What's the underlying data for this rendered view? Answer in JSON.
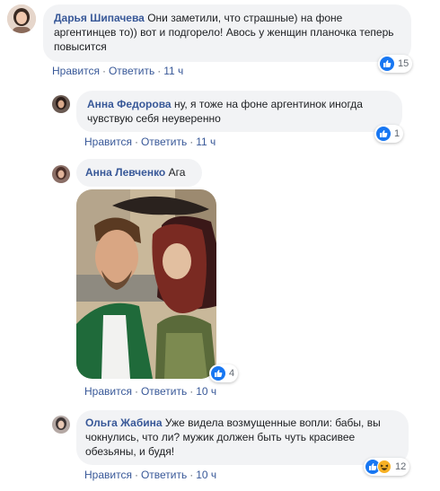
{
  "comments": [
    {
      "author": "Дарья Шипачева",
      "text": "Они заметили, что страшные) на фоне аргентинцев то)) вот и подгорело! Авось у женщин планочка теперь повысится",
      "like_label": "Нравится",
      "reply_label": "Ответить",
      "time": "11 ч",
      "reactions": [
        "like-icon"
      ],
      "reaction_count": "15"
    },
    {
      "author": "Анна Федорова",
      "text": "ну, я тоже на фоне аргентинок иногда чувствую себя неуверенно",
      "like_label": "Нравится",
      "reply_label": "Ответить",
      "time": "11 ч",
      "reactions": [
        "like-icon"
      ],
      "reaction_count": "1"
    },
    {
      "author": "Анна Левченко",
      "text": "Ага",
      "like_label": "Нравится",
      "reply_label": "Ответить",
      "time": "10 ч",
      "reactions": [
        "like-icon"
      ],
      "reaction_count": "4"
    },
    {
      "author": "Ольга Жабина",
      "text": "Уже видела возмущенные вопли: бабы, вы чокнулись, что ли? мужик должен быть чуть красивее обезьяны, и будя!",
      "like_label": "Нравится",
      "reply_label": "Ответить",
      "time": "10 ч",
      "reactions": [
        "like-icon",
        "haha-icon"
      ],
      "reaction_count": "12"
    }
  ],
  "colors": {
    "author": "#385898",
    "bubble": "#f2f3f5",
    "meta": "#606770",
    "like": "#1877f2",
    "haha": "#f7b125"
  }
}
